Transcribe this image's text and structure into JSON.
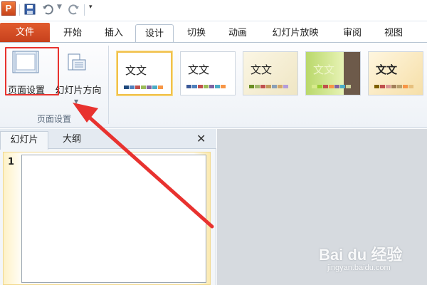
{
  "app": {
    "icon_letter": "P"
  },
  "tabs": {
    "file": "文件",
    "items": [
      "开始",
      "插入",
      "设计",
      "切换",
      "动画",
      "幻灯片放映",
      "审阅",
      "视图"
    ],
    "active": "设计"
  },
  "ribbon": {
    "page_setup_group": {
      "label": "页面设置",
      "page_setup_button": "页面设置",
      "slide_orientation_button": "幻灯片方向"
    },
    "themes": [
      {
        "text": "文文",
        "colors": [
          "#1f497d",
          "#4f81bd",
          "#c0504d",
          "#9bbb59",
          "#8064a2",
          "#4bacc6",
          "#f79646"
        ]
      },
      {
        "text": "文文",
        "colors": [
          "#3b5998",
          "#4f81bd",
          "#c0504d",
          "#9bbb59",
          "#8064a2",
          "#4bacc6",
          "#f79646"
        ]
      },
      {
        "text": "文文",
        "colors": [
          "#6b8e23",
          "#a3b86c",
          "#c0504d",
          "#c29b5a",
          "#8aa0b7",
          "#d4a76a",
          "#b39ddb"
        ]
      },
      {
        "text": "文文",
        "colors": [
          "#d8ea8c",
          "#9acd32",
          "#c0504d",
          "#f79646",
          "#8064a2",
          "#4bacc6",
          "#cfd39c"
        ]
      },
      {
        "text": "文文",
        "colors": [
          "#7f6000",
          "#c0504d",
          "#d99694",
          "#a3805a",
          "#b8a06d",
          "#f79646",
          "#e7c07d"
        ]
      }
    ]
  },
  "pane": {
    "tab_slides": "幻灯片",
    "tab_outline": "大纲",
    "slide_number": "1"
  },
  "watermark": {
    "brand": "Bai du 经验",
    "url": "jingyan.baidu.com"
  }
}
